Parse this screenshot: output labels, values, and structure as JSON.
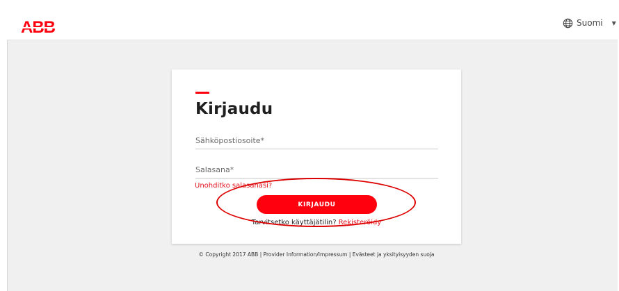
{
  "brand": {
    "logo_text": "ABB",
    "accent_color": "#ff000f"
  },
  "header": {
    "language_label": "Suomi",
    "language_icon": "globe-icon"
  },
  "login": {
    "title": "Kirjaudu",
    "email_placeholder": "Sähköpostiosoite*",
    "password_placeholder": "Salasana*",
    "forgot_link": "Unohditko salasanasi?",
    "submit_label": "KIRJAUDU",
    "register_prompt": "Tarvitsetko käyttäjätilin?",
    "register_link": "Rekisteröidy"
  },
  "footer": {
    "text": "© Copyright 2017 ABB | Provider Information/Impressum | Evästeet ja yksityisyyden suoja"
  }
}
